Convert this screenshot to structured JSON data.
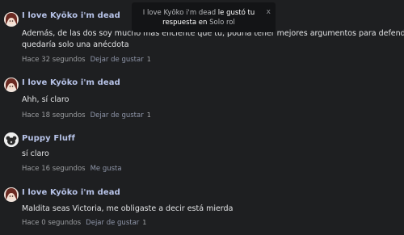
{
  "comments": [
    {
      "author": "I love Kyōko i'm dead",
      "text_line1": "Además, de las dos soy mucho más eficiente que tú, podría tener mejores argumentos para defenderme y e",
      "text_line2": "quedaría solo una anécdota",
      "time": "Hace 32 segundos",
      "action": "Dejar de gustar",
      "likes": "1",
      "avatar": "anime-girl-avatar"
    },
    {
      "author": "I love Kyōko i'm dead",
      "text_line1": "Ahh, sí claro",
      "time": "Hace 18 segundos",
      "action": "Dejar de gustar",
      "likes": "1",
      "avatar": "anime-girl-avatar"
    },
    {
      "author": "Puppy Fluff",
      "text_line1": "sí claro",
      "time": "Hace 16 segundos",
      "action": "Me gusta",
      "likes": "",
      "avatar": "puppy-avatar"
    },
    {
      "author": "I love Kyōko i'm dead",
      "text_line1": "Maldita seas Victoria, me obligaste a decir está mierda",
      "time": "Hace 0 segundos",
      "action": "Dejar de gustar",
      "likes": "1",
      "avatar": "anime-girl-avatar"
    }
  ],
  "toast": {
    "user": "I love Kyōko i'm dead",
    "phrase": "le gustó tu",
    "phrase2": "respuesta en",
    "place": "Solo rol",
    "close": "x"
  },
  "colors": {
    "background": "#1e1f21",
    "author": "#b7c3e8",
    "toast_bg": "#131416"
  }
}
